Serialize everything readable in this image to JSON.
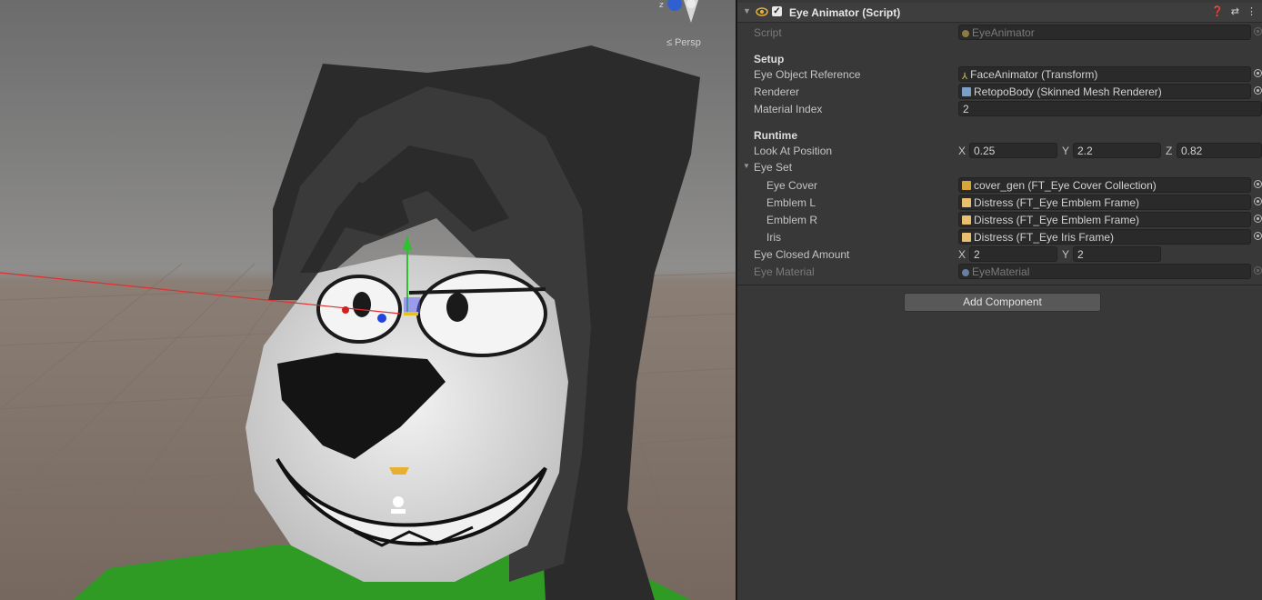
{
  "scene": {
    "persp_label": "≤ Persp",
    "gizmo_axis_label": "z"
  },
  "component": {
    "title": "Eye Animator (Script)",
    "enabled": true,
    "help_icon": "help-icon",
    "settings_icon": "preset-icon",
    "menu_icon": "kebab-menu-icon"
  },
  "fields": {
    "script": {
      "label": "Script",
      "value": "EyeAnimator"
    },
    "setup_header": "Setup",
    "eye_object_reference": {
      "label": "Eye Object Reference",
      "value": "FaceAnimator (Transform)"
    },
    "renderer": {
      "label": "Renderer",
      "value": "RetopoBody (Skinned Mesh Renderer)"
    },
    "material_index": {
      "label": "Material Index",
      "value": "2"
    },
    "runtime_header": "Runtime",
    "look_at_position": {
      "label": "Look At Position",
      "x_label": "X",
      "x": "0.25",
      "y_label": "Y",
      "y": "2.2",
      "z_label": "Z",
      "z": "0.82"
    },
    "eye_set": {
      "label": "Eye Set",
      "expanded": true
    },
    "eye_cover": {
      "label": "Eye Cover",
      "value": "cover_gen (FT_Eye Cover Collection)"
    },
    "emblem_l": {
      "label": "Emblem L",
      "value": "Distress (FT_Eye Emblem Frame)"
    },
    "emblem_r": {
      "label": "Emblem R",
      "value": "Distress (FT_Eye Emblem Frame)"
    },
    "iris": {
      "label": "Iris",
      "value": "Distress (FT_Eye Iris Frame)"
    },
    "eye_closed_amount": {
      "label": "Eye Closed Amount",
      "x_label": "X",
      "x": "2",
      "y_label": "Y",
      "y": "2"
    },
    "eye_material": {
      "label": "Eye Material",
      "value": "EyeMaterial"
    }
  },
  "add_component_label": "Add Component",
  "colors": {
    "inspector_bg": "#383838",
    "field_bg": "#2a2a2a",
    "viewport_sky": "#8e8c8a",
    "floor": "#6e655e",
    "hood": "#2b2b2b",
    "face": "#d8d8d8",
    "shirt": "#2f9a24"
  }
}
